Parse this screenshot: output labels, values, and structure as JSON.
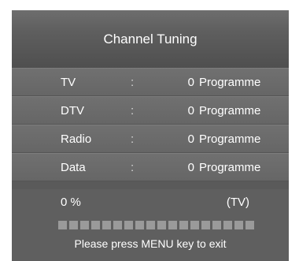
{
  "title": "Channel Tuning",
  "rows": [
    {
      "label": "TV",
      "sep": ":",
      "count": "0",
      "unit": "Programme"
    },
    {
      "label": "DTV",
      "sep": ":",
      "count": "0",
      "unit": "Programme"
    },
    {
      "label": "Radio",
      "sep": ":",
      "count": "0",
      "unit": "Programme"
    },
    {
      "label": "Data",
      "sep": ":",
      "count": "0",
      "unit": "Programme"
    }
  ],
  "status": {
    "progress_text": "0 %",
    "mode": "(TV)",
    "progress_fraction": 0,
    "segment_count": 18
  },
  "hint": "Please press MENU key to exit",
  "colors": {
    "panel": "#5a5a5a",
    "row": "#6b6b6b",
    "segment_empty": "#9a9a9a",
    "segment_filled": "#f2f2f2",
    "text": "#ffffff"
  }
}
